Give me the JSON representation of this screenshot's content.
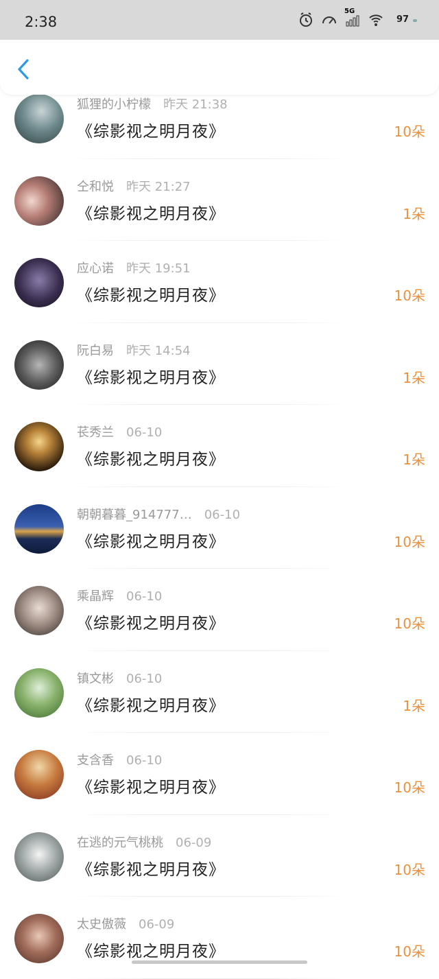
{
  "status_bar": {
    "time": "2:38",
    "network": "5G",
    "battery": "97"
  },
  "colors": {
    "accent_back": "#2b9ae6",
    "amount": "#e8913f"
  },
  "entries": [
    {
      "name": "狐狸的小柠檬",
      "time": "昨天 21:38",
      "book": "《综影视之明月夜》",
      "amount": "10朵"
    },
    {
      "name": "仝和悦",
      "time": "昨天 21:27",
      "book": "《综影视之明月夜》",
      "amount": "1朵"
    },
    {
      "name": "应心诺",
      "time": "昨天 19:51",
      "book": "《综影视之明月夜》",
      "amount": "10朵"
    },
    {
      "name": "阮白易",
      "time": "昨天 14:54",
      "book": "《综影视之明月夜》",
      "amount": "1朵"
    },
    {
      "name": "苌秀兰",
      "time": "06-10",
      "book": "《综影视之明月夜》",
      "amount": "1朵"
    },
    {
      "name": "朝朝暮暮_914777…",
      "time": "06-10",
      "book": "《综影视之明月夜》",
      "amount": "10朵"
    },
    {
      "name": "乘晶辉",
      "time": "06-10",
      "book": "《综影视之明月夜》",
      "amount": "10朵"
    },
    {
      "name": "镇文彬",
      "time": "06-10",
      "book": "《综影视之明月夜》",
      "amount": "1朵"
    },
    {
      "name": "支含香",
      "time": "06-10",
      "book": "《综影视之明月夜》",
      "amount": "10朵"
    },
    {
      "name": "在逃的元气桃桃",
      "time": "06-09",
      "book": "《综影视之明月夜》",
      "amount": "10朵"
    },
    {
      "name": "太史傲薇",
      "time": "06-09",
      "book": "《综影视之明月夜》",
      "amount": "10朵"
    }
  ]
}
